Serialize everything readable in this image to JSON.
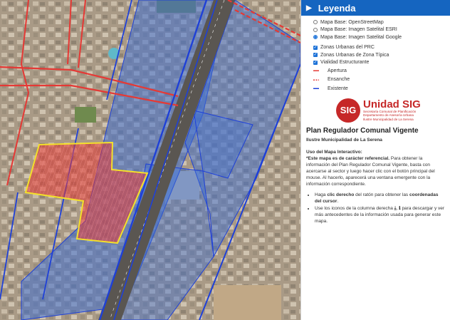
{
  "legend": {
    "title": "Leyenda",
    "base_layers": [
      {
        "label": "Mapa Base: OpenStreetMap",
        "selected": false
      },
      {
        "label": "Mapa Base: Imagen Satelital ESRI",
        "selected": false
      },
      {
        "label": "Mapa Base: Imagen Satelital Google",
        "selected": true
      }
    ],
    "overlays": [
      {
        "label": "Zonas Urbanas del PRC",
        "checked": true
      },
      {
        "label": "Zonas Urbanas de Zona Típica",
        "checked": true
      },
      {
        "label": "Vialidad Estructurante",
        "checked": true
      }
    ],
    "road_types": [
      {
        "label": "Apertura",
        "color": "#e53935",
        "style": "dashed"
      },
      {
        "label": "Ensanche",
        "color": "#e53935",
        "style": "dash-dot"
      },
      {
        "label": "Existente",
        "color": "#1e40d8",
        "style": "solid"
      }
    ]
  },
  "logo": {
    "badge": "SIG",
    "title": "Unidad SIG",
    "line1": "Secretaría Comunal de Planificación",
    "line2": "Departamento de Asesoría Urbana",
    "line3": "Ilustre Municipalidad de La Serena",
    "color": "#c62828"
  },
  "info": {
    "title": "Plan Regulador Comunal Vigente",
    "subtitle": "Ilustre Municipalidad de La Serena",
    "usage_heading": "Uso del Mapa Interactivo:",
    "usage_bold": "*Este mapa es de carácter referencial.",
    "usage_text": " Para obtener la información del Plan Regulador Comunal Vigente, basta con acercarse al sector y luego hacer clic con el botón principal del mouse. Al hacerlo, aparecerá una ventana emergente con la información correspondiente.",
    "bullet1_a": "Haga ",
    "bullet1_b": "clic derecho",
    "bullet1_c": " del ratón para obtener las ",
    "bullet1_d": "coordenadas del cursor",
    "bullet1_e": ".",
    "bullet2_a": "Use los iconos de la columna derecha ",
    "bullet2_icon1": "⤓",
    "bullet2_b": ", ",
    "bullet2_icon2": "ℹ",
    "bullet2_c": " para descargar y ver más antecedentes de la información usada para generar este mapa."
  },
  "map": {
    "zone_fill": "#3f6fd1",
    "road_existing": "#1e40d8",
    "road_opening": "#e53935",
    "typical_zone_fill": "#e53935",
    "typical_zone_border": "#f4e02a"
  }
}
